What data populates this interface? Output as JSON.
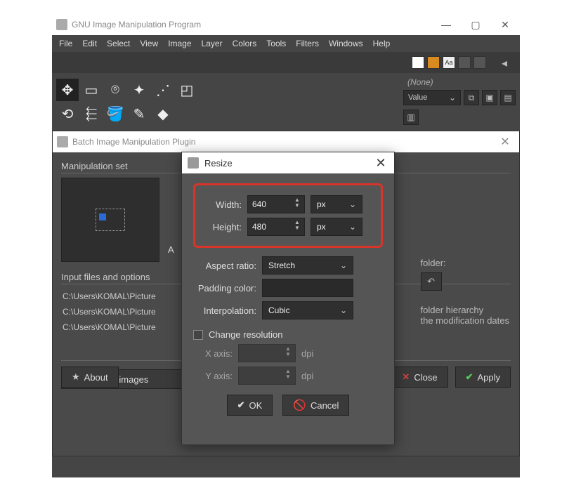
{
  "app": {
    "title": "GNU Image Manipulation Program",
    "menu": [
      "File",
      "Edit",
      "Select",
      "View",
      "Image",
      "Layer",
      "Colors",
      "Tools",
      "Filters",
      "Windows",
      "Help"
    ],
    "right_panel": {
      "none_label": "(None)",
      "value_label": "Value"
    }
  },
  "plugin": {
    "title": "Batch Image Manipulation Plugin",
    "manipulation_set_label": "Manipulation set",
    "input_files_label": "Input files and options",
    "files": [
      "C:\\Users\\KOMAL\\Picture",
      "C:\\Users\\KOMAL\\Picture",
      "C:\\Users\\KOMAL\\Picture"
    ],
    "add_images_label": "Add images",
    "folder_label": "folder:",
    "hierarchy_label": "folder hierarchy",
    "moddates_label": "the modification dates",
    "about_label": "About",
    "close_label": "Close",
    "apply_label": "Apply",
    "a_label": "A"
  },
  "resize": {
    "title": "Resize",
    "width_label": "Width:",
    "height_label": "Height:",
    "width_value": "640",
    "height_value": "480",
    "unit": "px",
    "aspect_label": "Aspect ratio:",
    "aspect_value": "Stretch",
    "padding_label": "Padding color:",
    "interpolation_label": "Interpolation:",
    "interpolation_value": "Cubic",
    "change_resolution_label": "Change resolution",
    "xaxis_label": "X axis:",
    "yaxis_label": "Y axis:",
    "dpi_label": "dpi",
    "ok_label": "OK",
    "cancel_label": "Cancel"
  }
}
